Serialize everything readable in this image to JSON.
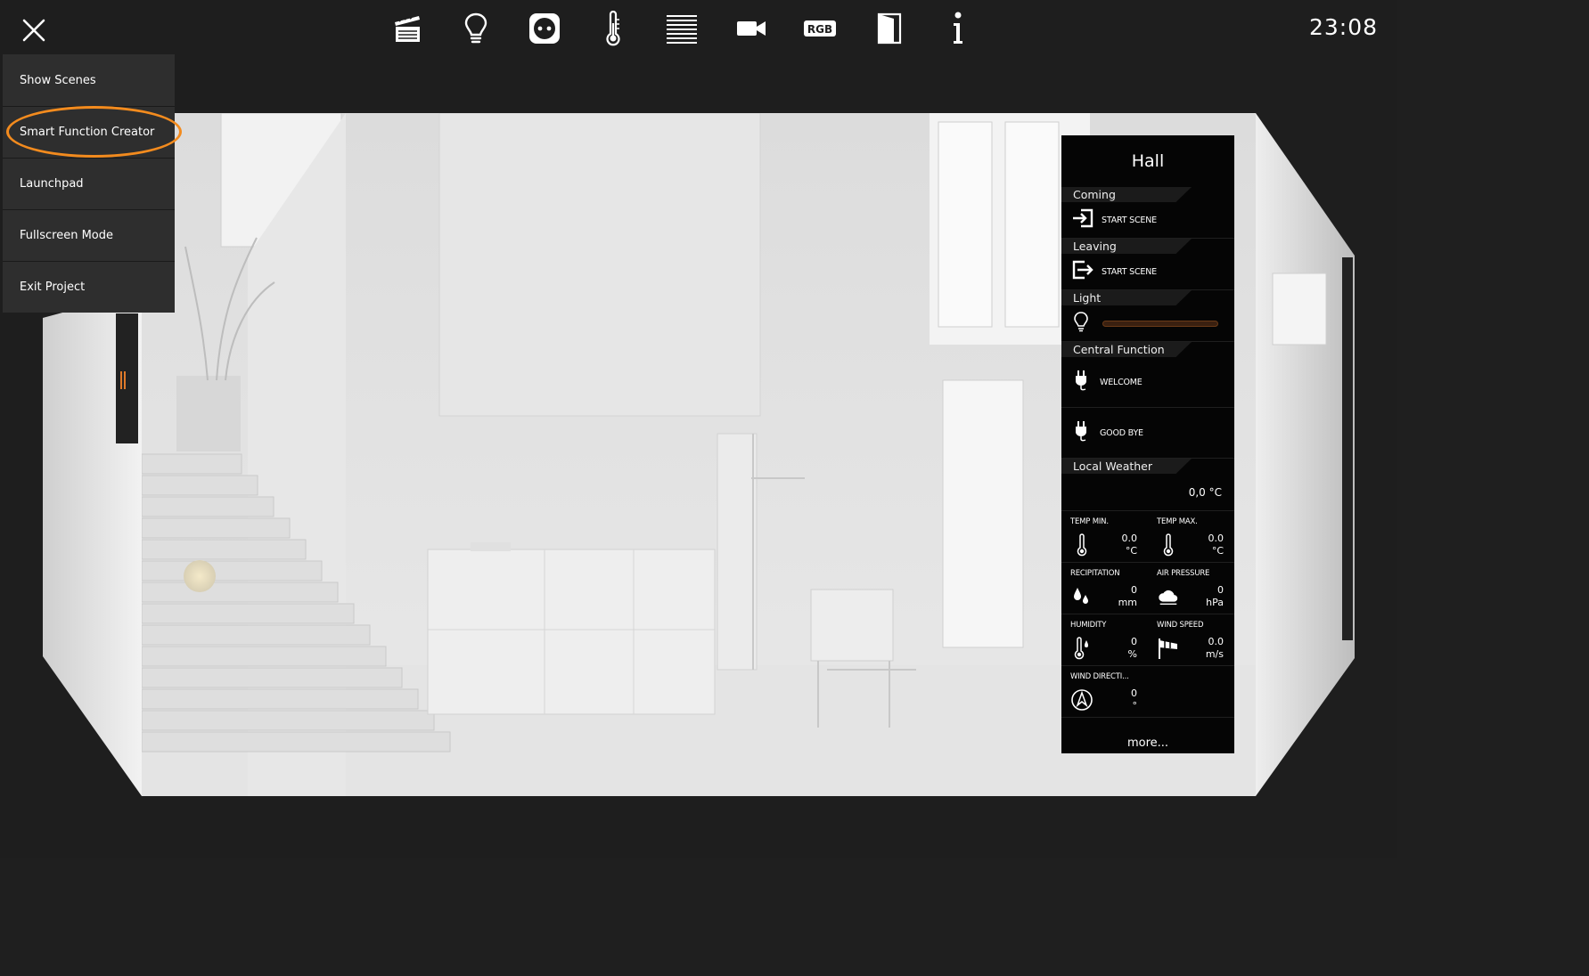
{
  "clock": "23:08",
  "toolbar": {
    "icons": [
      "scenes-icon",
      "light-bulb-icon",
      "socket-icon",
      "thermometer-icon",
      "blinds-icon",
      "camera-icon",
      "rgb-icon",
      "door-icon",
      "info-icon"
    ],
    "rgb_label": "RGB",
    "info_label": "i"
  },
  "menu": {
    "items": [
      {
        "label": "Show Scenes"
      },
      {
        "label": "Smart Function Creator"
      },
      {
        "label": "Launchpad"
      },
      {
        "label": "Fullscreen Mode"
      },
      {
        "label": "Exit Project"
      }
    ],
    "highlight_color": "#f38b1e"
  },
  "hall": {
    "title": "Hall",
    "coming": {
      "header": "Coming",
      "action": "START SCENE"
    },
    "leaving": {
      "header": "Leaving",
      "action": "START SCENE"
    },
    "light": {
      "header": "Light"
    },
    "central": {
      "header": "Central Function",
      "welcome": "WELCOME",
      "goodbye": "GOOD BYE"
    },
    "weather": {
      "header": "Local Weather",
      "current": "0,0 °C",
      "temp_min": {
        "label": "TEMP MIN.",
        "value": "0.0",
        "unit": "°C"
      },
      "temp_max": {
        "label": "TEMP MAX.",
        "value": "0.0",
        "unit": "°C"
      },
      "precipitation": {
        "label": "RECIPITATION",
        "value": "0",
        "unit": "mm"
      },
      "air_pressure": {
        "label": "AIR PRESSURE",
        "value": "0",
        "unit": "hPa"
      },
      "humidity": {
        "label": "HUMIDITY",
        "value": "0",
        "unit": "%"
      },
      "wind_speed": {
        "label": "WIND SPEED",
        "value": "0.0",
        "unit": "m/s"
      },
      "wind_direction": {
        "label": "WIND DIRECTI...",
        "value": "0",
        "unit": "°"
      }
    },
    "more": "more..."
  }
}
